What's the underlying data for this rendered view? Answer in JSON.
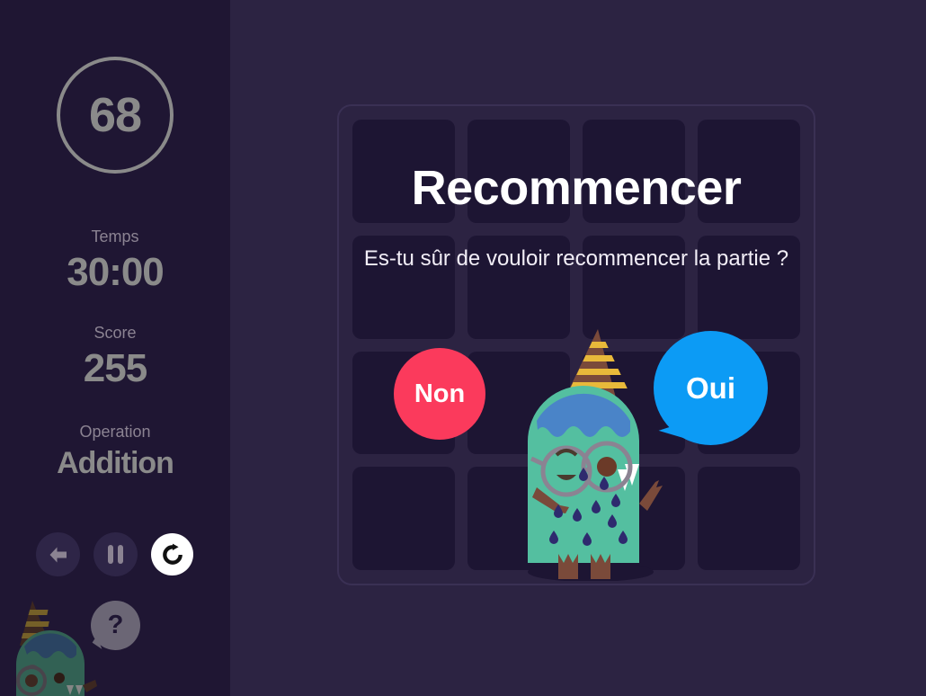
{
  "theme": {
    "sidebar_bg": "#1f1633",
    "main_bg": "#2c2342",
    "cell_bg": "#1d1533",
    "board_border": "#3a3054",
    "muted_text": "#8b8392",
    "value_text": "#8a8a8a",
    "accent_no": "#fb3a5c",
    "accent_yes": "#0c9bf5",
    "white": "#ffffff",
    "monster_body": "#54bfa0",
    "monster_hair": "#4a84c8",
    "monster_limbs": "#7a4a3a",
    "monster_spots": "#2e2a6e",
    "hat_stripe": "#e8b93a",
    "glasses": "#8b8392",
    "help_bubble": "#6b6675"
  },
  "sidebar": {
    "timer_ring": {
      "value": "68"
    },
    "stats": [
      {
        "id": "temps",
        "label": "Temps",
        "value": "30:00",
        "size": "large"
      },
      {
        "id": "score",
        "label": "Score",
        "value": "255",
        "size": "large"
      },
      {
        "id": "operation",
        "label": "Operation",
        "value": "Addition",
        "size": "small"
      }
    ],
    "controls": [
      {
        "id": "back",
        "icon": "arrow-left-icon",
        "active": false
      },
      {
        "id": "pause",
        "icon": "pause-icon",
        "active": false
      },
      {
        "id": "restart",
        "icon": "restart-icon",
        "active": true
      }
    ],
    "help": {
      "icon": "question-mark-icon",
      "label": "?"
    },
    "mascot": {
      "icon": "monster-mascot-icon"
    }
  },
  "board": {
    "rows": 4,
    "cols": 4,
    "cells": [
      "",
      "",
      "",
      "",
      "",
      "",
      "",
      "",
      "",
      "",
      "",
      "",
      "",
      "",
      "",
      ""
    ]
  },
  "dialog": {
    "title": "Recommencer",
    "message": "Es-tu sûr de vouloir recommencer la partie ?",
    "buttons": {
      "no": "Non",
      "yes": "Oui"
    },
    "mascot": {
      "icon": "monster-mascot-icon"
    }
  }
}
